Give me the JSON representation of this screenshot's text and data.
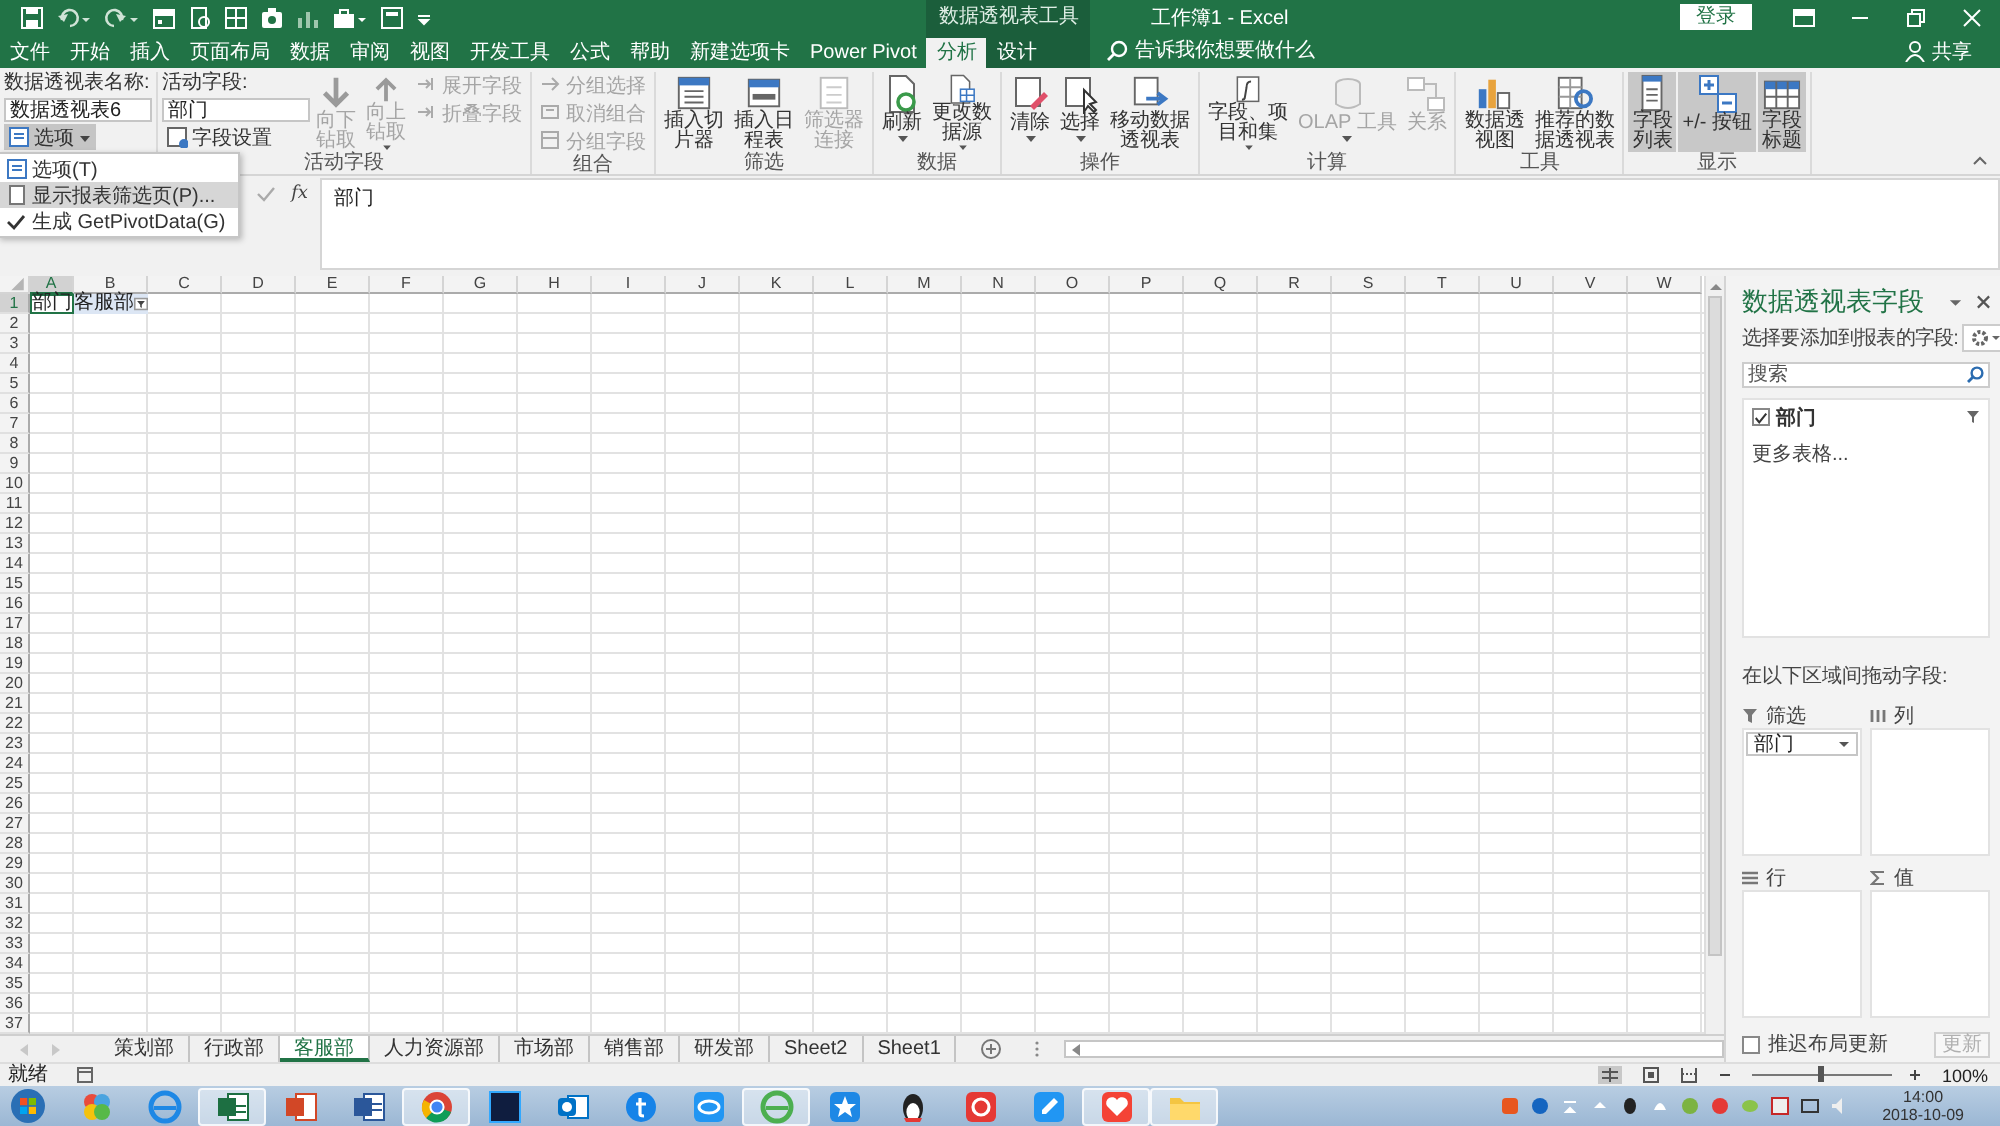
{
  "title_bar": {
    "context_label": "数据透视表工具",
    "title": "工作簿1 - Excel",
    "sign_in": "登录"
  },
  "ribbon_tabs": [
    {
      "label": "文件",
      "selected": false,
      "context": false
    },
    {
      "label": "开始",
      "selected": false,
      "context": false
    },
    {
      "label": "插入",
      "selected": false,
      "context": false
    },
    {
      "label": "页面布局",
      "selected": false,
      "context": false
    },
    {
      "label": "数据",
      "selected": false,
      "context": false
    },
    {
      "label": "审阅",
      "selected": false,
      "context": false
    },
    {
      "label": "视图",
      "selected": false,
      "context": false
    },
    {
      "label": "开发工具",
      "selected": false,
      "context": false
    },
    {
      "label": "公式",
      "selected": false,
      "context": false
    },
    {
      "label": "帮助",
      "selected": false,
      "context": false
    },
    {
      "label": "新建选项卡",
      "selected": false,
      "context": false
    },
    {
      "label": "Power Pivot",
      "selected": false,
      "context": false
    },
    {
      "label": "分析",
      "selected": true,
      "context": true
    },
    {
      "label": "设计",
      "selected": false,
      "context": true
    }
  ],
  "tell_me": {
    "placeholder": "告诉我你想要做什么"
  },
  "share": "共享",
  "ribbon_groups": [
    {
      "columns": [
        {
          "items": [
            {
              "kind": "caption",
              "label": "数据透视表名称:"
            },
            {
              "kind": "field",
              "value": "数据透视表6"
            },
            {
              "kind": "menu_button",
              "label": "选项",
              "expanded": true
            }
          ]
        }
      ]
    },
    {
      "label": "活动字段",
      "columns": [
        {
          "items": [
            {
              "kind": "caption",
              "label": "活动字段:"
            },
            {
              "kind": "field",
              "value": "部门"
            },
            {
              "kind": "small",
              "label": "字段设置",
              "disabled": false
            }
          ]
        },
        {
          "items": [
            {
              "kind": "large",
              "label": "向下钻取",
              "disabled": true
            }
          ]
        },
        {
          "items": [
            {
              "kind": "large",
              "label": "向上钻取",
              "disabled": true,
              "dropdown": true
            }
          ]
        },
        {
          "items": [
            {
              "kind": "small",
              "label": "展开字段",
              "disabled": true
            },
            {
              "kind": "small",
              "label": "折叠字段",
              "disabled": true
            }
          ]
        }
      ]
    },
    {
      "label": "组合",
      "columns": [
        {
          "items": [
            {
              "kind": "small",
              "label": "分组选择",
              "disabled": true
            },
            {
              "kind": "small",
              "label": "取消组合",
              "disabled": true
            },
            {
              "kind": "small",
              "label": "分组字段",
              "disabled": true
            }
          ]
        }
      ]
    },
    {
      "label": "筛选",
      "columns": [
        {
          "items": [
            {
              "kind": "large",
              "label": "插入切片器",
              "disabled": false
            }
          ]
        },
        {
          "items": [
            {
              "kind": "large",
              "label": "插入日程表",
              "disabled": false
            }
          ]
        },
        {
          "items": [
            {
              "kind": "large",
              "label": "筛选器连接",
              "disabled": true
            }
          ]
        }
      ]
    },
    {
      "label": "数据",
      "columns": [
        {
          "items": [
            {
              "kind": "large",
              "label": "刷新",
              "disabled": false,
              "dropdown": true
            }
          ]
        },
        {
          "items": [
            {
              "kind": "large",
              "label": "更改数据源",
              "disabled": false,
              "dropdown": true
            }
          ]
        }
      ]
    },
    {
      "label": "操作",
      "columns": [
        {
          "items": [
            {
              "kind": "large",
              "label": "清除",
              "disabled": false,
              "dropdown": true
            }
          ]
        },
        {
          "items": [
            {
              "kind": "large",
              "label": "选择",
              "disabled": false,
              "dropdown": true
            }
          ]
        },
        {
          "items": [
            {
              "kind": "large",
              "label": "移动数据透视表",
              "disabled": false
            }
          ]
        }
      ]
    },
    {
      "label": "计算",
      "columns": [
        {
          "items": [
            {
              "kind": "large",
              "label": "字段、项目和集",
              "disabled": false,
              "dropdown": true
            }
          ]
        },
        {
          "items": [
            {
              "kind": "large",
              "label": "OLAP 工具",
              "disabled": true,
              "dropdown": true
            }
          ]
        },
        {
          "items": [
            {
              "kind": "large",
              "label": "关系",
              "disabled": true
            }
          ]
        }
      ]
    },
    {
      "label": "工具",
      "columns": [
        {
          "items": [
            {
              "kind": "large",
              "label": "数据透视图",
              "disabled": false
            }
          ]
        },
        {
          "items": [
            {
              "kind": "large",
              "label": "推荐的数据透视表",
              "disabled": false
            }
          ]
        }
      ]
    },
    {
      "label": "显示",
      "columns": [
        {
          "items": [
            {
              "kind": "large",
              "label": "字段列表",
              "disabled": false,
              "selected": true
            }
          ]
        },
        {
          "items": [
            {
              "kind": "large",
              "label": "+/- 按钮",
              "disabled": false,
              "selected": true
            }
          ]
        },
        {
          "items": [
            {
              "kind": "large",
              "label": "字段标题",
              "disabled": false,
              "selected": true
            }
          ]
        }
      ]
    }
  ],
  "options_menu": {
    "items": [
      {
        "kind": "command",
        "label": "选项(T)",
        "selected": false
      },
      {
        "kind": "command",
        "label": "显示报表筛选页(P)...",
        "selected": true
      },
      {
        "kind": "toggle",
        "label": "生成 GetPivotData(G)",
        "selected": false,
        "checked": true
      }
    ]
  },
  "formula_bar": {
    "function_label": "fx",
    "value": "部门"
  },
  "sheet": {
    "columns": [
      "A",
      "B",
      "C",
      "D",
      "E",
      "F",
      "G",
      "H",
      "I",
      "J",
      "K",
      "L",
      "M",
      "N",
      "O",
      "P",
      "Q",
      "R",
      "S",
      "T",
      "U",
      "V",
      "W"
    ],
    "rows": [
      {
        "number": "1",
        "cells": [
          {
            "text": "部门",
            "selected": true,
            "filter": false
          },
          {
            "text": "客服部",
            "selected": false,
            "filter": true
          }
        ]
      },
      {
        "number": "2"
      },
      {
        "number": "3"
      },
      {
        "number": "4"
      },
      {
        "number": "5"
      },
      {
        "number": "6"
      },
      {
        "number": "7"
      },
      {
        "number": "8"
      },
      {
        "number": "9"
      },
      {
        "number": "10"
      },
      {
        "number": "11"
      },
      {
        "number": "12"
      },
      {
        "number": "13"
      },
      {
        "number": "14"
      },
      {
        "number": "15"
      },
      {
        "number": "16"
      },
      {
        "number": "17"
      },
      {
        "number": "18"
      },
      {
        "number": "19"
      },
      {
        "number": "20"
      },
      {
        "number": "21"
      },
      {
        "number": "22"
      },
      {
        "number": "23"
      },
      {
        "number": "24"
      },
      {
        "number": "25"
      },
      {
        "number": "26"
      },
      {
        "number": "27"
      },
      {
        "number": "28"
      },
      {
        "number": "29"
      },
      {
        "number": "30"
      },
      {
        "number": "31"
      },
      {
        "number": "32"
      },
      {
        "number": "33"
      },
      {
        "number": "34"
      },
      {
        "number": "35"
      },
      {
        "number": "36"
      },
      {
        "number": "37"
      }
    ]
  },
  "sheet_tabs": [
    {
      "label": "策划部",
      "selected": false
    },
    {
      "label": "行政部",
      "selected": false
    },
    {
      "label": "客服部",
      "selected": true
    },
    {
      "label": "人力资源部",
      "selected": false
    },
    {
      "label": "市场部",
      "selected": false
    },
    {
      "label": "销售部",
      "selected": false
    },
    {
      "label": "研发部",
      "selected": false
    },
    {
      "label": "Sheet2",
      "selected": false
    },
    {
      "label": "Sheet1",
      "selected": false
    }
  ],
  "status_bar": {
    "status": "就绪",
    "zoom_slider": {
      "level": 0.5
    },
    "zoom": "100%"
  },
  "pivot_pane": {
    "title": "数据透视表字段",
    "subtitle": "选择要添加到报表的字段:",
    "search": {
      "placeholder": "搜索"
    },
    "fields": [
      {
        "label": "部门",
        "checked": true
      }
    ],
    "more_tables": "更多表格...",
    "areas_caption": "在以下区域间拖动字段:",
    "areas": [
      {
        "kind": "filter",
        "label": "筛选",
        "items": [
          "部门"
        ]
      },
      {
        "kind": "columns",
        "label": "列"
      },
      {
        "kind": "rows",
        "label": "行"
      },
      {
        "kind": "values",
        "label": "值"
      }
    ],
    "defer": {
      "label": "推迟布局更新",
      "checked": false
    },
    "update_button": {
      "label": "更新",
      "disabled": true
    }
  },
  "taskbar": {
    "apps": [
      {
        "running": false
      },
      {
        "running": false
      },
      {
        "running": true
      },
      {
        "running": false
      },
      {
        "running": false
      },
      {
        "running": true
      },
      {
        "running": false
      },
      {
        "running": false
      },
      {
        "running": false
      },
      {
        "running": false
      },
      {
        "running": true
      },
      {
        "running": false
      },
      {
        "running": false
      },
      {
        "running": false
      },
      {
        "running": false
      },
      {
        "running": true
      },
      {
        "running": true
      }
    ],
    "clock": {
      "time": "14:00",
      "date": "2018-10-09"
    }
  }
}
